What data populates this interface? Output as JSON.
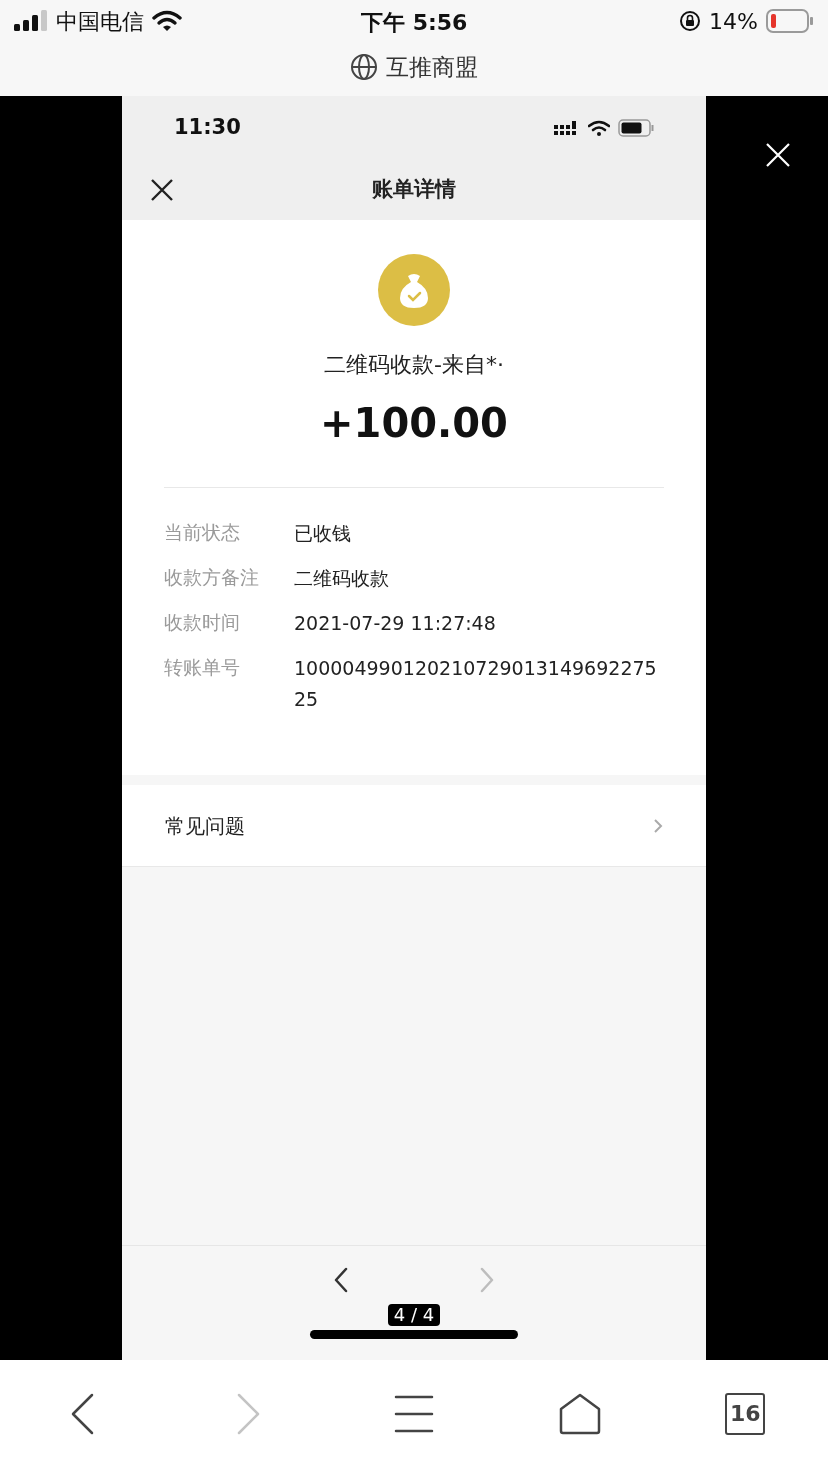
{
  "status_bar": {
    "carrier": "中国电信",
    "time": "下午 5:56",
    "battery": "14%"
  },
  "address_bar": {
    "title": "互推商盟"
  },
  "viewer": {
    "counter": "4 / 4",
    "screenshot": {
      "status_time": "11:30",
      "nav_title": "账单详情",
      "payment": {
        "title": "二维码收款-来自*·",
        "amount": "+100.00"
      },
      "details": [
        {
          "label": "当前状态",
          "value": "已收钱"
        },
        {
          "label": "收款方备注",
          "value": "二维码收款"
        },
        {
          "label": "收款时间",
          "value": "2021-07-29 11:27:48"
        },
        {
          "label": "转账单号",
          "value": "10000499012021072901314969227525"
        }
      ],
      "faq": "常见问题",
      "pager": [
        {
          "kind": "prev",
          "disabled": false
        },
        {
          "kind": "next",
          "disabled": true
        }
      ]
    }
  },
  "toolbar": [
    {
      "kind": "back",
      "disabled": false
    },
    {
      "kind": "forward",
      "disabled": true
    },
    {
      "kind": "menu",
      "disabled": false
    },
    {
      "kind": "home",
      "disabled": false
    },
    {
      "kind": "tabs",
      "label": "16",
      "disabled": false
    }
  ]
}
